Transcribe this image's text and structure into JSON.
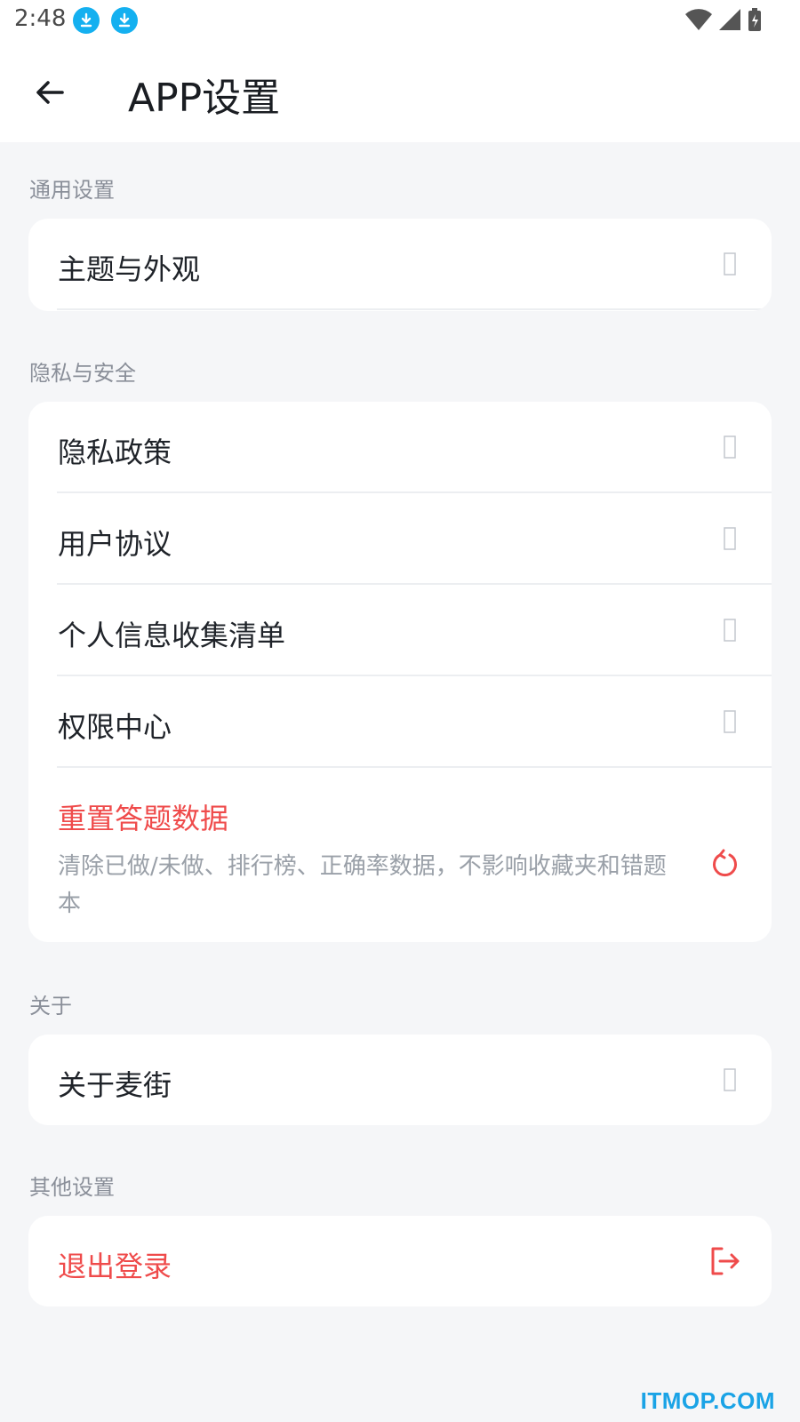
{
  "status_bar": {
    "time": "2:48"
  },
  "app_bar": {
    "title": "APP设置"
  },
  "sections": {
    "general": {
      "label": "通用设置",
      "items": [
        "主题与外观"
      ]
    },
    "privacy": {
      "label": "隐私与安全",
      "items": [
        "隐私政策",
        "用户协议",
        "个人信息收集清单",
        "权限中心"
      ],
      "reset": {
        "title": "重置答题数据",
        "desc": "清除已做/未做、排行榜、正确率数据，不影响收藏夹和错题本"
      }
    },
    "about": {
      "label": "关于",
      "items": [
        "关于麦街"
      ]
    },
    "other": {
      "label": "其他设置",
      "logout": "退出登录"
    }
  },
  "watermark": "ITMOP.COM",
  "colors": {
    "danger": "#ef4b4b",
    "accent_download": "#14b0f0",
    "background": "#f5f6f8"
  }
}
